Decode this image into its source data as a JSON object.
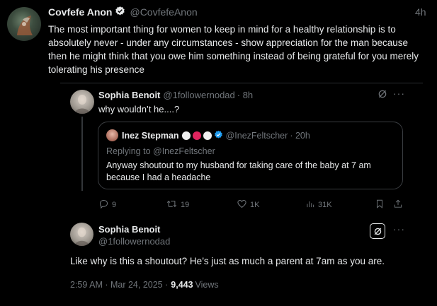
{
  "main_tweet": {
    "name": "Covfefe Anon",
    "handle": "@CovfefeAnon",
    "time": "4h",
    "text": "The most important thing for women to keep in mind for a healthy relationship is to absolutely never - under any circumstances - show appreciation for the man because then he might think that you owe him something instead of being grateful for you merely tolerating his presence"
  },
  "quoted_tweet": {
    "name": "Sophia Benoit",
    "handle": "@1followernodad",
    "time": "· 8h",
    "text": "why wouldn’t he....?",
    "inner": {
      "name": "Inez Stepman",
      "handle": "@InezFeltscher",
      "time": "· 20h",
      "replying": "Replying to @InezFeltscher",
      "text": "Anyway shoutout to my husband for taking care of the baby at 7 am because I had a headache"
    },
    "actions": {
      "replies": "9",
      "retweets": "19",
      "likes": "1K",
      "views": "31K"
    }
  },
  "reply_tweet": {
    "name": "Sophia Benoit",
    "handle": "@1followernodad",
    "text": "Like why is this a shoutout? He’s just as much a parent at 7am as you are.",
    "timestamp": "2:59 AM · Mar 24, 2025 ·",
    "views_count": "9,443",
    "views_label": "Views"
  },
  "colors": {
    "background": "#000000",
    "text": "#e7e9ea",
    "muted": "#71767b",
    "verified": "#1d9bf0",
    "red_circle": "#e0245e",
    "white_circle": "#f0f0f0"
  },
  "icons": [
    "verified-badge-icon",
    "grok-icon",
    "more-icon",
    "reply-icon",
    "retweet-icon",
    "like-icon",
    "views-icon",
    "bookmark-icon",
    "share-icon"
  ]
}
